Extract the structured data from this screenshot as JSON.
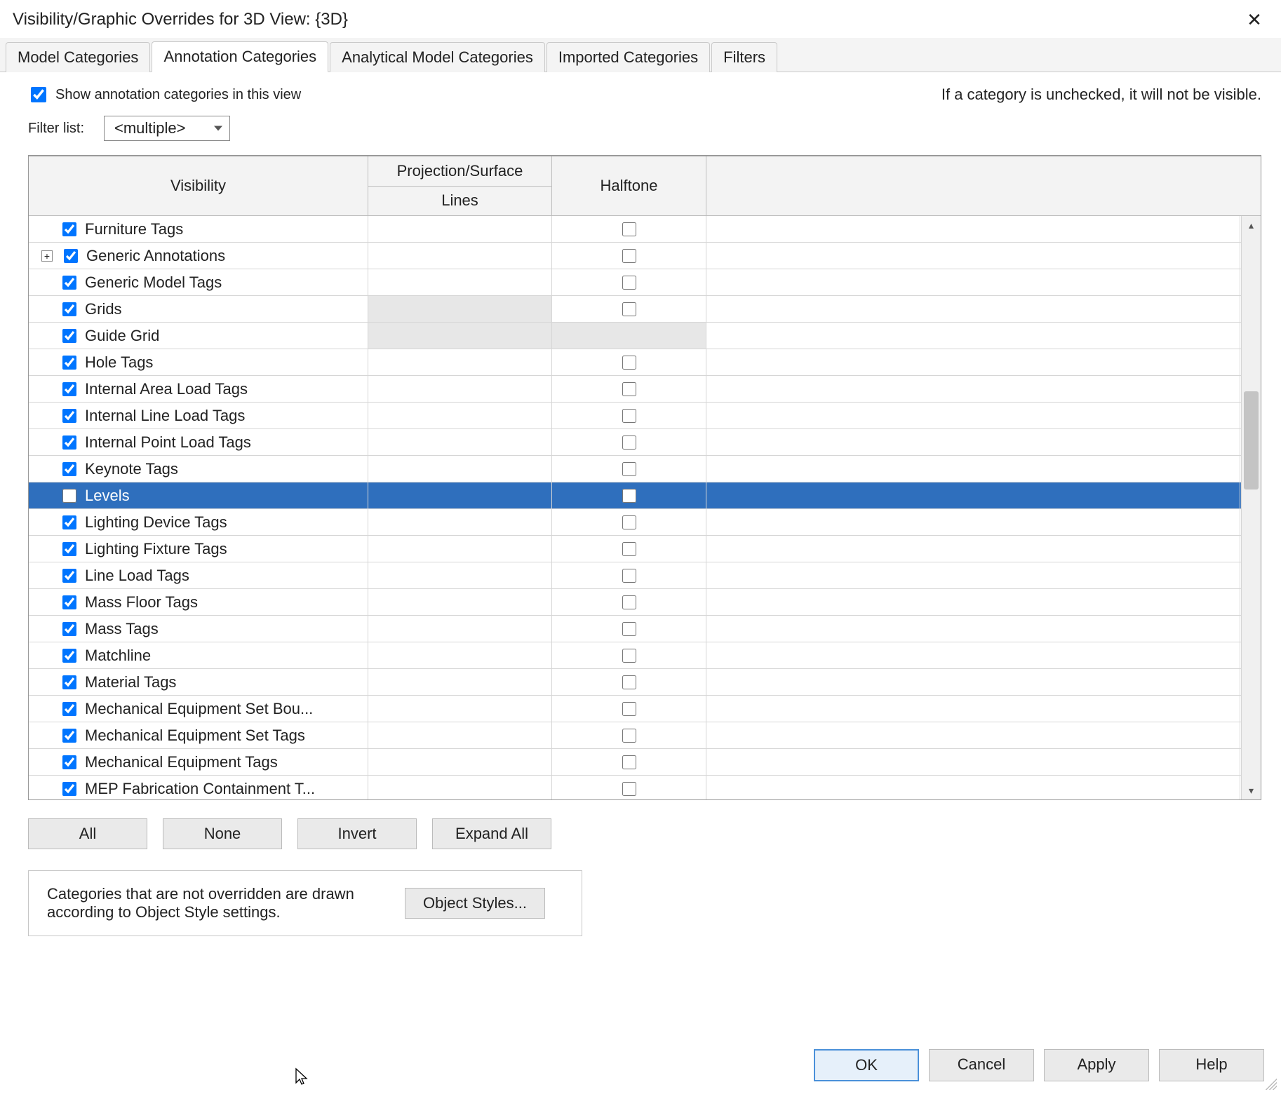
{
  "title": "Visibility/Graphic Overrides for 3D View: {3D}",
  "tabs": [
    "Model Categories",
    "Annotation Categories",
    "Analytical Model Categories",
    "Imported Categories",
    "Filters"
  ],
  "active_tab_index": 1,
  "show_checkbox_label": "Show annotation categories in this view",
  "show_checkbox_checked": true,
  "hint_text": "If a category is unchecked, it will not be visible.",
  "filter_label": "Filter list:",
  "filter_value": "<multiple>",
  "columns": {
    "visibility": "Visibility",
    "projection": "Projection/Surface",
    "lines": "Lines",
    "halftone": "Halftone"
  },
  "rows": [
    {
      "name": "Furniture Tags",
      "checked": true,
      "expandable": false,
      "selected": false,
      "proj_disabled": false,
      "half_disabled": false,
      "half_checked": false
    },
    {
      "name": "Generic Annotations",
      "checked": true,
      "expandable": true,
      "selected": false,
      "proj_disabled": false,
      "half_disabled": false,
      "half_checked": false
    },
    {
      "name": "Generic Model Tags",
      "checked": true,
      "expandable": false,
      "selected": false,
      "proj_disabled": false,
      "half_disabled": false,
      "half_checked": false
    },
    {
      "name": "Grids",
      "checked": true,
      "expandable": false,
      "selected": false,
      "proj_disabled": true,
      "half_disabled": false,
      "half_checked": false
    },
    {
      "name": "Guide Grid",
      "checked": true,
      "expandable": false,
      "selected": false,
      "proj_disabled": true,
      "half_disabled": true,
      "half_checked": false
    },
    {
      "name": "Hole Tags",
      "checked": true,
      "expandable": false,
      "selected": false,
      "proj_disabled": false,
      "half_disabled": false,
      "half_checked": false
    },
    {
      "name": "Internal Area Load Tags",
      "checked": true,
      "expandable": false,
      "selected": false,
      "proj_disabled": false,
      "half_disabled": false,
      "half_checked": false
    },
    {
      "name": "Internal Line Load Tags",
      "checked": true,
      "expandable": false,
      "selected": false,
      "proj_disabled": false,
      "half_disabled": false,
      "half_checked": false
    },
    {
      "name": "Internal Point Load Tags",
      "checked": true,
      "expandable": false,
      "selected": false,
      "proj_disabled": false,
      "half_disabled": false,
      "half_checked": false
    },
    {
      "name": "Keynote Tags",
      "checked": true,
      "expandable": false,
      "selected": false,
      "proj_disabled": false,
      "half_disabled": false,
      "half_checked": false
    },
    {
      "name": "Levels",
      "checked": false,
      "expandable": false,
      "selected": true,
      "proj_disabled": false,
      "half_disabled": false,
      "half_checked": false
    },
    {
      "name": "Lighting Device Tags",
      "checked": true,
      "expandable": false,
      "selected": false,
      "proj_disabled": false,
      "half_disabled": false,
      "half_checked": false
    },
    {
      "name": "Lighting Fixture Tags",
      "checked": true,
      "expandable": false,
      "selected": false,
      "proj_disabled": false,
      "half_disabled": false,
      "half_checked": false
    },
    {
      "name": "Line Load Tags",
      "checked": true,
      "expandable": false,
      "selected": false,
      "proj_disabled": false,
      "half_disabled": false,
      "half_checked": false
    },
    {
      "name": "Mass Floor Tags",
      "checked": true,
      "expandable": false,
      "selected": false,
      "proj_disabled": false,
      "half_disabled": false,
      "half_checked": false
    },
    {
      "name": "Mass Tags",
      "checked": true,
      "expandable": false,
      "selected": false,
      "proj_disabled": false,
      "half_disabled": false,
      "half_checked": false
    },
    {
      "name": "Matchline",
      "checked": true,
      "expandable": false,
      "selected": false,
      "proj_disabled": false,
      "half_disabled": false,
      "half_checked": false
    },
    {
      "name": "Material Tags",
      "checked": true,
      "expandable": false,
      "selected": false,
      "proj_disabled": false,
      "half_disabled": false,
      "half_checked": false
    },
    {
      "name": "Mechanical Equipment Set Bou...",
      "checked": true,
      "expandable": false,
      "selected": false,
      "proj_disabled": false,
      "half_disabled": false,
      "half_checked": false
    },
    {
      "name": "Mechanical Equipment Set Tags",
      "checked": true,
      "expandable": false,
      "selected": false,
      "proj_disabled": false,
      "half_disabled": false,
      "half_checked": false
    },
    {
      "name": "Mechanical Equipment Tags",
      "checked": true,
      "expandable": false,
      "selected": false,
      "proj_disabled": false,
      "half_disabled": false,
      "half_checked": false
    },
    {
      "name": "MEP Fabrication Containment T...",
      "checked": true,
      "expandable": false,
      "selected": false,
      "proj_disabled": false,
      "half_disabled": false,
      "half_checked": false
    }
  ],
  "buttons": {
    "all": "All",
    "none": "None",
    "invert": "Invert",
    "expand_all": "Expand All",
    "object_styles": "Object Styles..."
  },
  "info_text": "Categories that are not overridden are drawn according to Object Style settings.",
  "footer": {
    "ok": "OK",
    "cancel": "Cancel",
    "apply": "Apply",
    "help": "Help"
  }
}
